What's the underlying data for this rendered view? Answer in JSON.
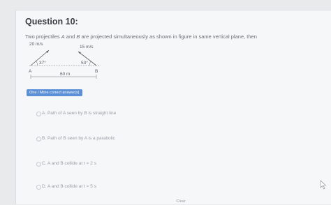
{
  "question": {
    "title": "Question 10:",
    "text": "Two projectiles A and B are projected simultaneously as shown in figure in same vertical plane, then",
    "text_parts": {
      "p1": "Two projectiles ",
      "a": "A",
      "p2": " and ",
      "b": "B",
      "p3": " are projected simultaneously as shown in figure in same vertical plane, then"
    }
  },
  "figure": {
    "speed_a": "20 m/s",
    "speed_b": "15 m/s",
    "angle_a": "37°",
    "angle_b": "53°",
    "label_a": "A",
    "label_b": "B",
    "distance": "60 m"
  },
  "tag": {
    "label": "One / More correct answer(s)"
  },
  "options": [
    {
      "label": "A. Path of A seen by B is straight line"
    },
    {
      "label": "B. Path of B seen by A is a parabolic"
    },
    {
      "label": "C. A and B collide at t = 2 s"
    },
    {
      "label": "D. A and B collide at t = 5 s"
    }
  ],
  "footer": {
    "clear_label": "Clear"
  },
  "colors": {
    "accent": "#5b8fd6",
    "background": "#e9eaec",
    "card": "#f6f7f8"
  }
}
